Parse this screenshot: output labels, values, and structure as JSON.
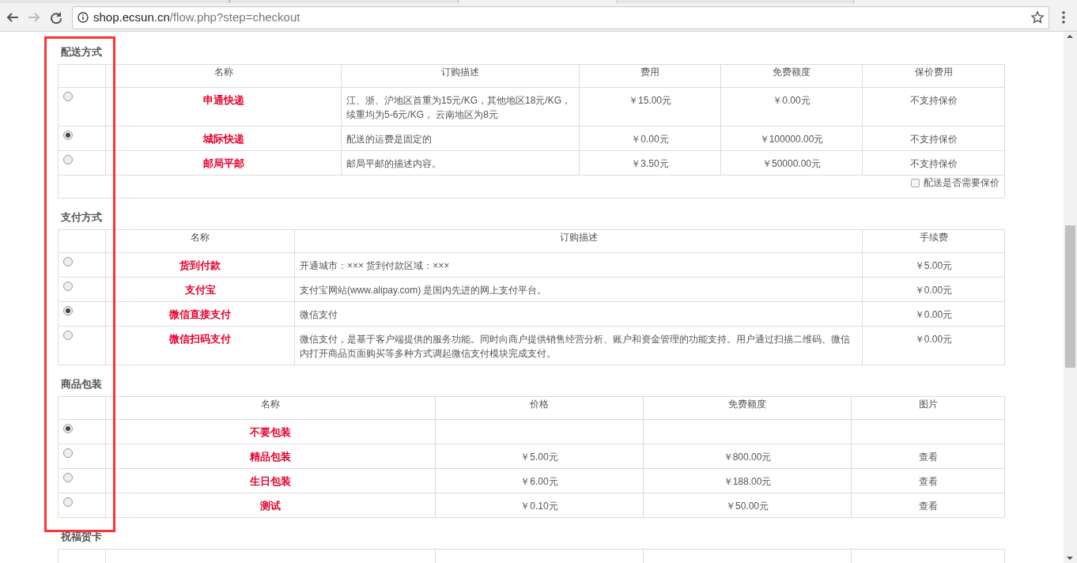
{
  "browser": {
    "url_host": "shop.ecsun.cn",
    "url_path": "/flow.php?step=checkout"
  },
  "sections": [
    {
      "title": "配送方式",
      "kind": "shipping",
      "columns": [
        "名称",
        "订购描述",
        "费用",
        "免费额度",
        "保价费用"
      ],
      "rows": [
        {
          "selected": false,
          "cells": [
            "申通快递",
            "江、浙、沪地区首重为15元/KG，其他地区18元/KG，续重均为5-6元/KG， 云南地区为8元",
            "￥15.00元",
            "￥0.00元",
            "不支持保价"
          ]
        },
        {
          "selected": true,
          "cells": [
            "城际快递",
            "配送的运费是固定的",
            "￥0.00元",
            "￥100000.00元",
            "不支持保价"
          ]
        },
        {
          "selected": false,
          "cells": [
            "邮局平邮",
            "邮局平邮的描述内容。",
            "￥3.50元",
            "￥50000.00元",
            "不支持保价"
          ]
        }
      ],
      "footer": {
        "label": "配送是否需要保价",
        "checked": false
      }
    },
    {
      "title": "支付方式",
      "kind": "payment",
      "columns": [
        "名称",
        "订购描述",
        "手续费"
      ],
      "rows": [
        {
          "selected": false,
          "cells": [
            "货到付款",
            "开通城市：×××  货到付款区域：×××",
            "￥5.00元"
          ]
        },
        {
          "selected": false,
          "cells": [
            "支付宝",
            "支付宝网站(www.alipay.com) 是国内先进的网上支付平台。",
            "￥0.00元"
          ]
        },
        {
          "selected": true,
          "cells": [
            "微信直接支付",
            "微信支付",
            "￥0.00元"
          ]
        },
        {
          "selected": false,
          "cells": [
            "微信扫码支付",
            "微信支付，是基于客户端提供的服务功能。同时向商户提供销售经营分析、账户和资金管理的功能支持。用户通过扫描二维码、微信内打开商品页面购买等多种方式调起微信支付模块完成支付。",
            "￥0.00元"
          ]
        }
      ]
    },
    {
      "title": "商品包装",
      "kind": "packaging",
      "columns": [
        "名称",
        "价格",
        "免费额度",
        "图片"
      ],
      "rows": [
        {
          "selected": true,
          "cells": [
            "不要包装",
            null,
            null,
            null
          ]
        },
        {
          "selected": false,
          "cells": [
            "精品包装",
            "￥5.00元",
            "￥800.00元",
            {
              "link": "查看"
            }
          ]
        },
        {
          "selected": false,
          "cells": [
            "生日包装",
            "￥6.00元",
            "￥188.00元",
            {
              "link": "查看"
            }
          ]
        },
        {
          "selected": false,
          "cells": [
            "测试",
            "￥0.10元",
            "￥50.00元",
            {
              "link": "查看"
            }
          ]
        }
      ]
    },
    {
      "title": "祝福贺卡",
      "kind": "cards"
    }
  ]
}
